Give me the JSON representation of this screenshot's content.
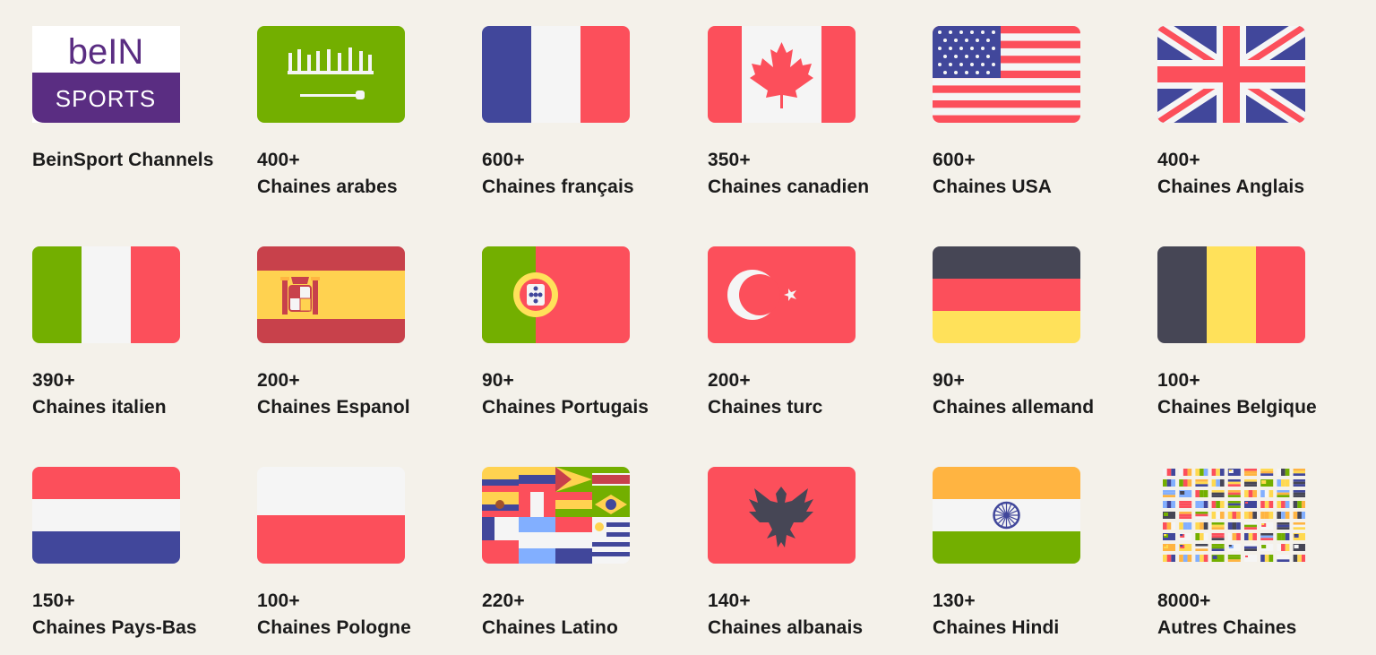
{
  "items": [
    {
      "count": "",
      "label": "BeinSport Channels",
      "flag": "bein-sports-logo",
      "logo_top": "beIN",
      "logo_bottom": "SPORTS"
    },
    {
      "count": "400+",
      "label": "Chaines arabes",
      "flag": "saudi-arabia-flag"
    },
    {
      "count": "600+",
      "label": "Chaines français",
      "flag": "france-flag"
    },
    {
      "count": "350+",
      "label": "Chaines canadien",
      "flag": "canada-flag"
    },
    {
      "count": "600+",
      "label": "Chaines USA",
      "flag": "usa-flag"
    },
    {
      "count": "400+",
      "label": "Chaines Anglais",
      "flag": "uk-flag"
    },
    {
      "count": "390+",
      "label": "Chaines italien",
      "flag": "italy-flag"
    },
    {
      "count": "200+",
      "label": "Chaines Espanol",
      "flag": "spain-flag"
    },
    {
      "count": "90+",
      "label": "Chaines Portugais",
      "flag": "portugal-flag"
    },
    {
      "count": "200+",
      "label": "Chaines turc",
      "flag": "turkey-flag"
    },
    {
      "count": "90+",
      "label": "Chaines allemand",
      "flag": "germany-flag"
    },
    {
      "count": "100+",
      "label": "Chaines Belgique",
      "flag": "belgium-flag"
    },
    {
      "count": "150+",
      "label": "Chaines Pays-Bas",
      "flag": "netherlands-flag"
    },
    {
      "count": "100+",
      "label": "Chaines Pologne",
      "flag": "poland-flag"
    },
    {
      "count": "220+",
      "label": "Chaines Latino",
      "flag": "latin-america-flags"
    },
    {
      "count": "140+",
      "label": "Chaines albanais",
      "flag": "albania-flag"
    },
    {
      "count": "130+",
      "label": "Chaines Hindi",
      "flag": "india-flag"
    },
    {
      "count": "8000+",
      "label": "Autres Chaines",
      "flag": "world-flags-collage"
    }
  ],
  "colors": {
    "background": "#f4f1ea",
    "text": "#1b1b1b",
    "red": "#fc4f5b",
    "blue": "#41479b",
    "green": "#73af00",
    "yellow": "#ffd950",
    "white": "#f5f5f5",
    "dark": "#464655",
    "bein_purple": "#5a2d82"
  }
}
